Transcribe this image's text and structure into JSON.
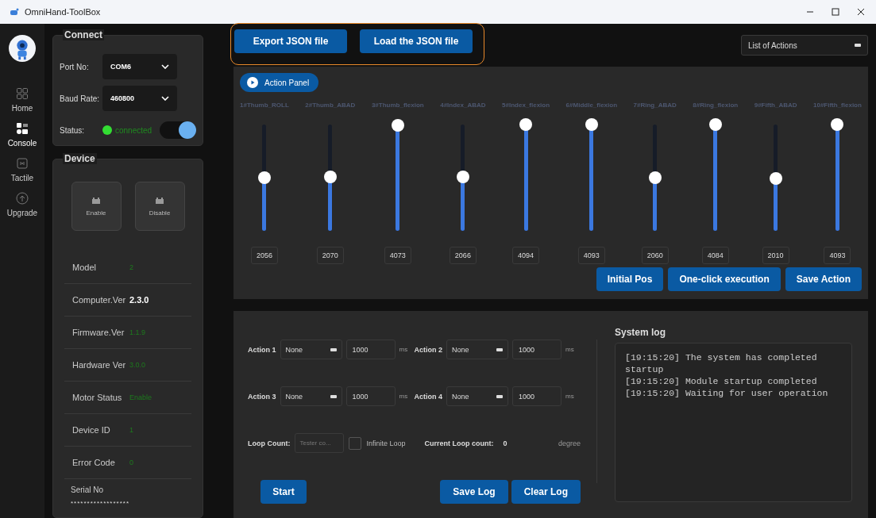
{
  "window": {
    "title": "OmniHand-ToolBox"
  },
  "nav": [
    {
      "label": "Home",
      "selected": false,
      "kind": "home"
    },
    {
      "label": "Console",
      "selected": true,
      "kind": "console"
    },
    {
      "label": "Tactile",
      "selected": false,
      "kind": "tactile"
    },
    {
      "label": "Upgrade",
      "selected": false,
      "kind": "upgrade"
    }
  ],
  "connect": {
    "title": "Connect",
    "port_label": "Port No:",
    "port": "COM6",
    "baud_label": "Baud Rate:",
    "baud": "460800",
    "status_label": "Status:",
    "status": "connected",
    "status_connected": true,
    "switch_on": true
  },
  "device": {
    "title": "Device",
    "buttons": [
      "Enable",
      "Disable"
    ],
    "info": [
      {
        "label": "Model",
        "value": "2",
        "kind": "plain"
      },
      {
        "label": "Computer.Ver",
        "value": "2.3.0",
        "kind": "strong"
      },
      {
        "label": "Firmware.Ver",
        "value": "1.1.9",
        "kind": "plain"
      },
      {
        "label": "Hardware Ver",
        "value": "3.0.0",
        "kind": "plain"
      },
      {
        "label": "Motor Status",
        "value": "Enable",
        "kind": "plain"
      },
      {
        "label": "Device ID",
        "value": "1",
        "kind": "plain"
      },
      {
        "label": "Error Code",
        "value": "0",
        "kind": "plain"
      }
    ],
    "serial_label": "Serial No",
    "serial": "******************"
  },
  "toolbar": {
    "buttons": [
      "Export JSON file",
      "Load the JSON file"
    ],
    "actions_dropdown": "List of Actions"
  },
  "action_panel": {
    "title": "Action Panel",
    "joints": [
      {
        "name": "1#Thumb_ROLL",
        "value": "2056",
        "level": 0.502
      },
      {
        "name": "2#Thumb_ABAD",
        "value": "2070",
        "level": 0.505
      },
      {
        "name": "3#Thumb_flexion",
        "value": "4073",
        "level": 0.995
      },
      {
        "name": "4#Index_ABAD",
        "value": "2066",
        "level": 0.505
      },
      {
        "name": "5#Index_flexion",
        "value": "4094",
        "level": 1.0
      },
      {
        "name": "6#Middle_flexion",
        "value": "4093",
        "level": 1.0
      },
      {
        "name": "7#Ring_ABAD",
        "value": "2060",
        "level": 0.503
      },
      {
        "name": "8#Ring_flexion",
        "value": "4084",
        "level": 0.997
      },
      {
        "name": "9#Fifth_ABAD",
        "value": "2010",
        "level": 0.491
      },
      {
        "name": "10#Fifth_flexion",
        "value": "4093",
        "level": 1.0
      }
    ],
    "buttons": [
      "Initial Pos",
      "One-click execution",
      "Save Action"
    ]
  },
  "sequence": {
    "actions": [
      {
        "label": "Action 1",
        "choice": "None",
        "time": "1000",
        "unit": "ms"
      },
      {
        "label": "Action 2",
        "choice": "None",
        "time": "1000",
        "unit": "ms"
      },
      {
        "label": "Action 3",
        "choice": "None",
        "time": "1000",
        "unit": "ms"
      },
      {
        "label": "Action 4",
        "choice": "None",
        "time": "1000",
        "unit": "ms"
      }
    ],
    "loop_label": "Loop Count:",
    "loop_placeholder": "Tester co...",
    "infinite_label": "Infinite Loop",
    "infinite_checked": false,
    "current_label": "Current Loop count:",
    "current": "0",
    "current_unit": "degree",
    "start": "Start",
    "save_log": "Save Log",
    "clear_log": "Clear Log"
  },
  "log": {
    "title": "System log",
    "lines": [
      "[19:15:20] The system has completed startup",
      "[19:15:20] Module startup completed",
      "[19:15:20] Waiting for user operation"
    ]
  }
}
